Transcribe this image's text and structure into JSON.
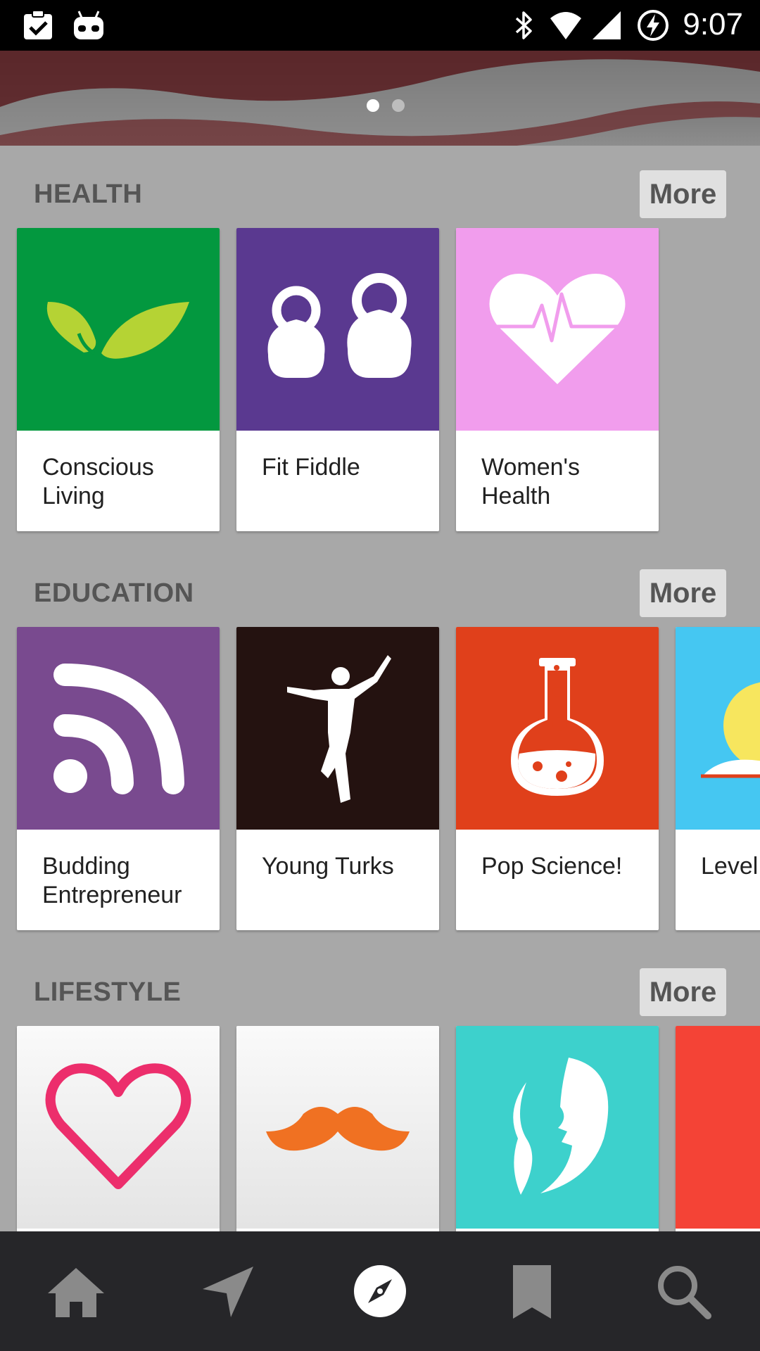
{
  "status_bar": {
    "time": "9:07",
    "icons": [
      "clipboard-check-icon",
      "cyanogen-icon",
      "bluetooth-icon",
      "wifi-icon",
      "cell-signal-icon",
      "battery-charging-icon"
    ]
  },
  "banner": {
    "page_indicator": {
      "count": 2,
      "active": 1
    }
  },
  "sections": [
    {
      "title": "HEALTH",
      "more_label": "More",
      "cards": [
        {
          "label": "Conscious Living",
          "color": "#03983f",
          "icon": "leaves-icon"
        },
        {
          "label": "Fit Fiddle",
          "color": "#5a3990",
          "icon": "kettlebells-icon"
        },
        {
          "label": "Women's Health",
          "color": "#f19ded",
          "icon": "heart-pulse-icon"
        }
      ]
    },
    {
      "title": "EDUCATION",
      "more_label": "More",
      "cards": [
        {
          "label": "Budding Entrepreneur",
          "color": "#794a8f",
          "icon": "rss-icon"
        },
        {
          "label": "Young Turks",
          "color": "#241210",
          "icon": "jumping-person-icon"
        },
        {
          "label": "Pop Science!",
          "color": "#e0401b",
          "icon": "flask-icon"
        },
        {
          "label": "Level",
          "color": "#45c7f2",
          "icon": "sunrise-book-icon"
        }
      ]
    },
    {
      "title": "LIFESTYLE",
      "more_label": "More",
      "cards": [
        {
          "label": "",
          "color": "#f0f0f0",
          "icon": "heart-outline-icon"
        },
        {
          "label": "",
          "color": "#eeeeee",
          "icon": "mustache-icon"
        },
        {
          "label": "",
          "color": "#3dd1cc",
          "icon": "woman-profile-icon"
        },
        {
          "label": "",
          "color": "#f44336",
          "icon": ""
        }
      ]
    }
  ],
  "bottom_nav": {
    "items": [
      "home-icon",
      "send-icon",
      "explore-icon",
      "bookmark-icon",
      "search-icon"
    ],
    "active": "explore-icon",
    "active_color": "#ffffff",
    "inactive_color": "#8a8a8a"
  }
}
